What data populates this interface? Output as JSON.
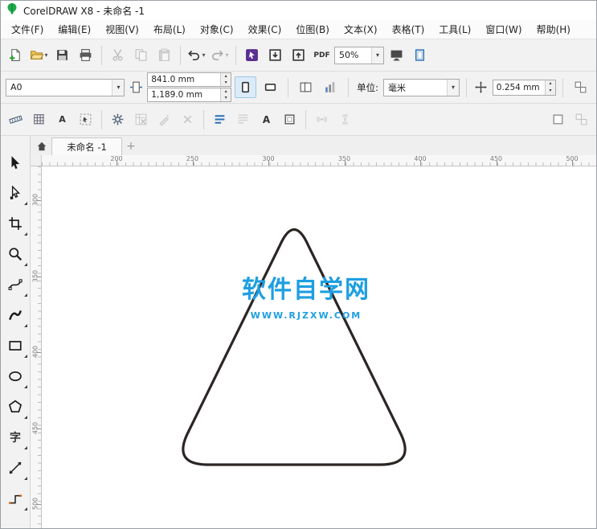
{
  "titlebar": {
    "title": "CorelDRAW X8 - 未命名 -1"
  },
  "menubar": {
    "items": [
      "文件(F)",
      "编辑(E)",
      "视图(V)",
      "布局(L)",
      "对象(C)",
      "效果(C)",
      "位图(B)",
      "文本(X)",
      "表格(T)",
      "工具(L)",
      "窗口(W)",
      "帮助(H)"
    ]
  },
  "toolbar_standard": {
    "buttons": [
      {
        "type": "button",
        "name": "new-document-button",
        "icon": "new-doc"
      },
      {
        "type": "button",
        "name": "open-button",
        "icon": "open-folder",
        "caret": true
      },
      {
        "type": "button",
        "name": "save-button",
        "icon": "save"
      },
      {
        "type": "button",
        "name": "print-button",
        "icon": "print"
      },
      {
        "type": "sep"
      },
      {
        "type": "button",
        "name": "cut-button",
        "icon": "cut",
        "disabled": true
      },
      {
        "type": "button",
        "name": "copy-button",
        "icon": "copy",
        "disabled": true
      },
      {
        "type": "button",
        "name": "paste-button",
        "icon": "paste",
        "disabled": true
      },
      {
        "type": "sep"
      },
      {
        "type": "button",
        "name": "undo-button",
        "icon": "undo",
        "caret": true
      },
      {
        "type": "button",
        "name": "redo-button",
        "icon": "redo",
        "caret": true,
        "disabled": true
      },
      {
        "type": "sep"
      },
      {
        "type": "button",
        "name": "search-content-button",
        "icon": "launcher"
      },
      {
        "type": "button",
        "name": "import-button",
        "icon": "import"
      },
      {
        "type": "button",
        "name": "export-button",
        "icon": "export"
      },
      {
        "type": "button",
        "name": "publish-pdf-button",
        "icon": "pdf"
      },
      {
        "type": "combo",
        "name": "zoom-level-combobox",
        "value": "50%",
        "width": 62
      },
      {
        "type": "button",
        "name": "fullscreen-preview-button",
        "icon": "fullscreen"
      },
      {
        "type": "button",
        "name": "show-rulers-button",
        "icon": "pageframe"
      }
    ]
  },
  "property_bar": {
    "page_size_value": "A0",
    "page_width_value": "841.0 mm",
    "page_height_value": "1,189.0 mm",
    "units_label": "单位:",
    "units_value": "毫米",
    "nudge_value": "0.254 mm"
  },
  "toolbar_secondary": {
    "buttons": [
      {
        "type": "button",
        "name": "dimension-style-button",
        "icon": "level"
      },
      {
        "type": "button",
        "name": "grid-toggle-button",
        "icon": "grid"
      },
      {
        "type": "button",
        "name": "text-grid-button",
        "icon": "textA"
      },
      {
        "type": "button",
        "name": "marquee-select-button",
        "icon": "dotsel"
      },
      {
        "type": "sep"
      },
      {
        "type": "button",
        "name": "options-button",
        "icon": "gear"
      },
      {
        "type": "button",
        "name": "table-tools-button",
        "icon": "tablex",
        "disabled": true
      },
      {
        "type": "button",
        "name": "edit-path-button",
        "icon": "penx",
        "disabled": true
      },
      {
        "type": "button",
        "name": "delete-button",
        "icon": "xplain",
        "disabled": true
      },
      {
        "type": "sep"
      },
      {
        "type": "button",
        "name": "bullet-list-button",
        "icon": "listblue"
      },
      {
        "type": "button",
        "name": "paragraph-format-button",
        "icon": "paraicon",
        "disabled": true
      },
      {
        "type": "button",
        "name": "character-format-button",
        "icon": "Abold"
      },
      {
        "type": "button",
        "name": "text-frame-button",
        "icon": "framesm"
      },
      {
        "type": "sep"
      },
      {
        "type": "button",
        "name": "h-spacing-button",
        "icon": "hspace",
        "disabled": true
      },
      {
        "type": "button",
        "name": "v-spacing-button",
        "icon": "vspace",
        "disabled": true
      },
      {
        "type": "space"
      },
      {
        "type": "button",
        "name": "frame-button",
        "icon": "boxsm"
      },
      {
        "type": "button",
        "name": "frame-options-button",
        "icon": "dupdist",
        "disabled": true
      }
    ]
  },
  "document_tabs": {
    "active_tab": "未命名 -1",
    "new_tab_label": "+"
  },
  "rulers": {
    "horizontal_labels": [
      "200",
      "250",
      "300",
      "350",
      "400",
      "450",
      "500"
    ],
    "vertical_labels": [
      "300",
      "350",
      "400",
      "450",
      "500"
    ]
  },
  "toolbox": {
    "tools": [
      {
        "name": "pick-tool",
        "icon": "pick",
        "flyout": false
      },
      {
        "name": "shape-tool",
        "icon": "shape",
        "flyout": true
      },
      {
        "name": "crop-tool",
        "icon": "crop",
        "flyout": true
      },
      {
        "name": "zoom-tool",
        "icon": "zoom",
        "flyout": true
      },
      {
        "name": "freehand-tool",
        "icon": "freehand",
        "flyout": true
      },
      {
        "name": "artistic-media-tool",
        "icon": "artistic",
        "flyout": true
      },
      {
        "name": "rectangle-tool",
        "icon": "rect-tool",
        "flyout": true
      },
      {
        "name": "ellipse-tool",
        "icon": "ellipse-tool",
        "flyout": true
      },
      {
        "name": "polygon-tool",
        "icon": "polygon-tool",
        "flyout": true
      },
      {
        "name": "text-tool",
        "icon": "text-tool",
        "flyout": true
      },
      {
        "name": "parallel-dimension-tool",
        "icon": "dimension",
        "flyout": true
      },
      {
        "name": "connector-tool",
        "icon": "connector",
        "flyout": true
      }
    ]
  },
  "canvas": {
    "shape": {
      "type": "rounded-triangle",
      "stroke": "#2b2624",
      "fill": "#ffffff"
    },
    "watermark": {
      "line1": "软件自学网",
      "line2": "WWW.RJZXW.COM",
      "color": "#1d9fe1"
    }
  }
}
